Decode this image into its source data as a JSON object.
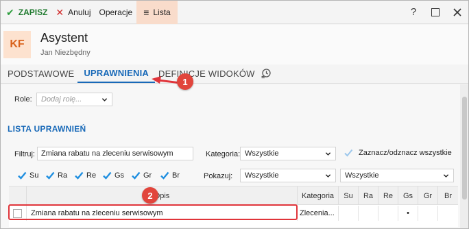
{
  "toolbar": {
    "save_label": "ZAPISZ",
    "cancel_label": "Anuluj",
    "operations_label": "Operacje",
    "list_label": "Lista",
    "help_symbol": "?"
  },
  "header": {
    "avatar_initials": "KF",
    "title": "Asystent",
    "subtitle": "Jan Niezbędny"
  },
  "tabs": [
    {
      "label": "PODSTAWOWE"
    },
    {
      "label": "UPRAWNIENIA",
      "active": true
    },
    {
      "label": "DEFINICJE WIDOKÓW"
    }
  ],
  "roles": {
    "label": "Role:",
    "placeholder": "Dodaj rolę..."
  },
  "section_title": "LISTA UPRAWNIEŃ",
  "filters": {
    "filter_label": "Filtruj:",
    "filter_value": "Zmiana rabatu na zleceniu serwisowym",
    "category_label": "Kategoria:",
    "category_value": "Wszystkie",
    "toggle_all_label": "Zaznacz/odznacz wszystkie",
    "show_label": "Pokazuj:",
    "show_value_1": "Wszystkie",
    "show_value_2": "Wszystkie"
  },
  "checkboxes": [
    "Su",
    "Ra",
    "Re",
    "Gs",
    "Gr",
    "Br"
  ],
  "table": {
    "columns": [
      "",
      "Opis",
      "Kategoria",
      "Su",
      "Ra",
      "Re",
      "Gs",
      "Gr",
      "Br"
    ],
    "rows": [
      [
        "",
        "Zmiana rabatu na zleceniu serwisowym",
        "Zlecenia...",
        "",
        "",
        "",
        "•",
        "",
        ""
      ]
    ]
  },
  "annotations": [
    "1",
    "2"
  ],
  "colors": {
    "accent": "#1869b8",
    "save_green": "#2e9e3e",
    "cancel_red": "#d12b2b",
    "annotation_red": "#e1453c",
    "list_tab_bg": "#f9dccb",
    "avatar_bg": "#fde2cf",
    "avatar_fg": "#d9621c"
  }
}
